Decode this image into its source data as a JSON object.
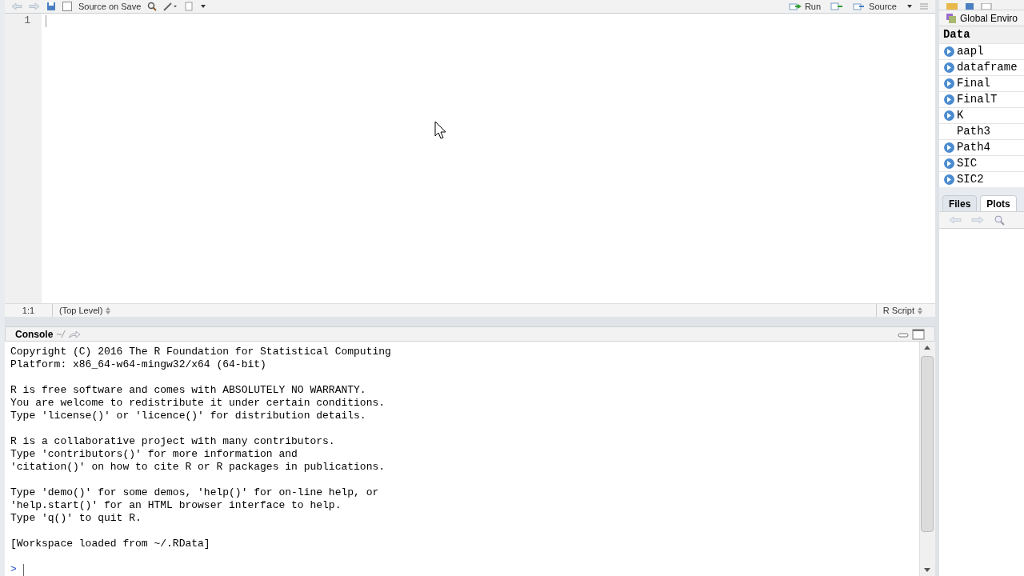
{
  "editor": {
    "toolbar": {
      "source_on_save": {
        "label": "Source on Save",
        "checked": false
      },
      "run": "Run",
      "source": "Source"
    },
    "line_numbers": [
      "1"
    ],
    "status_bar": {
      "position": "1:1",
      "scope": "(Top Level)",
      "file_type": "R Script"
    }
  },
  "console": {
    "title": "Console",
    "path": "~/",
    "paragraphs": [
      [
        "Copyright (C) 2016 The R Foundation for Statistical Computing",
        "Platform: x86_64-w64-mingw32/x64 (64-bit)"
      ],
      [
        "R is free software and comes with ABSOLUTELY NO WARRANTY.",
        "You are welcome to redistribute it under certain conditions.",
        "Type 'license()' or 'licence()' for distribution details."
      ],
      [
        "R is a collaborative project with many contributors.",
        "Type 'contributors()' for more information and",
        "'citation()' on how to cite R or R packages in publications."
      ],
      [
        "Type 'demo()' for some demos, 'help()' for on-line help, or",
        "'help.start()' for an HTML browser interface to help.",
        "Type 'q()' to quit R."
      ],
      [
        "[Workspace loaded from ~/.RData]"
      ]
    ],
    "prompt": ">"
  },
  "environment": {
    "scope": "Global Enviro",
    "section": "Data",
    "items": [
      {
        "name": "aapl",
        "expandable": true
      },
      {
        "name": "dataframe",
        "expandable": true
      },
      {
        "name": "Final",
        "expandable": true
      },
      {
        "name": "FinalT",
        "expandable": true
      },
      {
        "name": "K",
        "expandable": true
      },
      {
        "name": "Path3",
        "expandable": false
      },
      {
        "name": "Path4",
        "expandable": true
      },
      {
        "name": "SIC",
        "expandable": true
      },
      {
        "name": "SIC2",
        "expandable": true
      }
    ]
  },
  "files_pane": {
    "tabs": [
      {
        "label": "Files",
        "selected": false
      },
      {
        "label": "Plots",
        "selected": true
      }
    ]
  }
}
